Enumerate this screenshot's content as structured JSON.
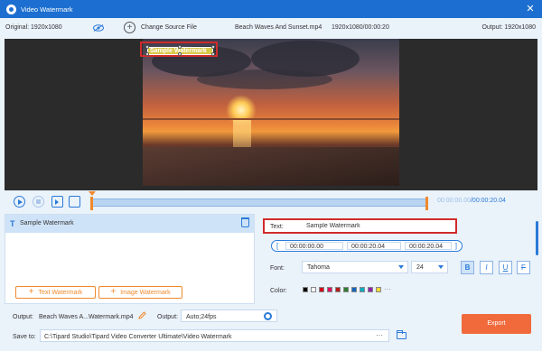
{
  "window": {
    "title": "Video Watermark",
    "close": "✕"
  },
  "info": {
    "original": "Original: 1920x1080",
    "change_source": "Change Source File",
    "filename": "Beach Waves And Sunset.mp4",
    "res_duration": "1920x1080/00:00:20",
    "output": "Output: 1920x1080"
  },
  "preview": {
    "watermark_text": "Sample Watermark"
  },
  "playback": {
    "current_time": "00:00:00.00",
    "total_time": "/00:00:20.04"
  },
  "watermark_list": {
    "items": [
      {
        "label": "Sample Watermark"
      }
    ]
  },
  "buttons": {
    "text_watermark": "Text Watermark",
    "image_watermark": "Image Watermark",
    "export": "Export"
  },
  "settings": {
    "text_label": "Text:",
    "text_value": "Sample Watermark",
    "start_time": "00:00:00.00",
    "end_time": "00:00:20.04",
    "duration": "00:00:20.04",
    "font_label": "Font:",
    "font_value": "Tahoma",
    "size_value": "24",
    "bold": "B",
    "italic": "I",
    "underline": "U",
    "strike": "F",
    "color_label": "Color:",
    "colors": [
      "#000000",
      "#ffffff",
      "#d0021b",
      "#e0115f",
      "#b71c1c",
      "#2e7d32",
      "#1565c0",
      "#00acc1",
      "#8e24aa",
      "#fdd835"
    ],
    "more_colors": "···"
  },
  "bottom": {
    "output_label": "Output:",
    "output_file": "Beach Waves A...Watermark.mp4",
    "output2_label": "Output:",
    "output_format": "Auto;24fps",
    "save_label": "Save to:",
    "save_path": "C:\\Tipard Studio\\Tipard Video Converter Ultimate\\Video Watermark",
    "browse": "···"
  },
  "colors": {
    "accent": "#2a7ad8",
    "titlebar": "#1c6fd0",
    "orange": "#f08a2c",
    "export": "#f06a3c",
    "highlight": "#d12b2b"
  }
}
